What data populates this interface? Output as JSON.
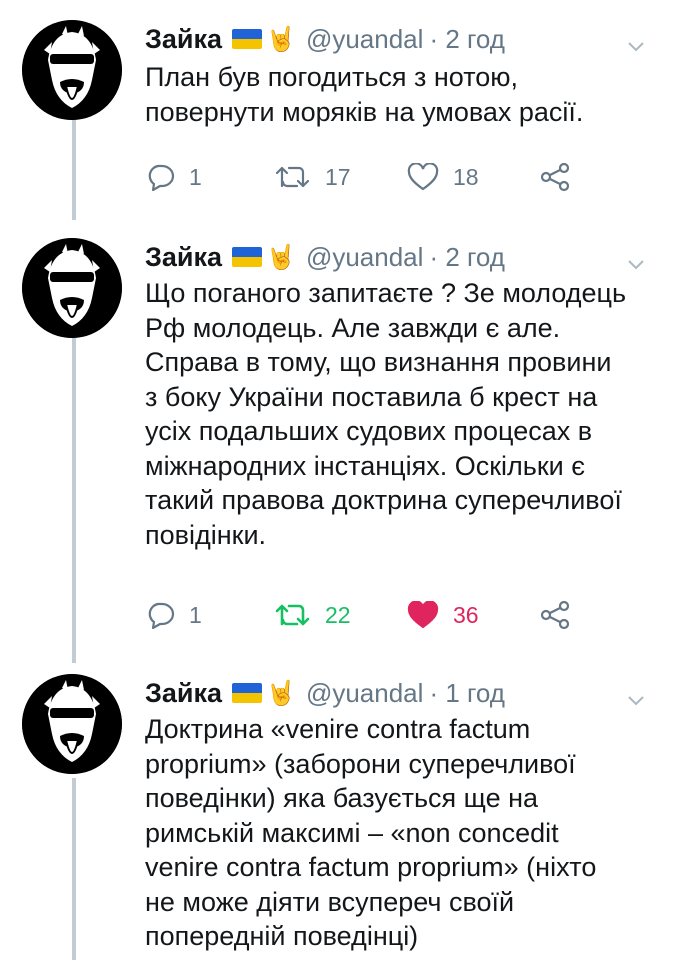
{
  "tweets": [
    {
      "name": "Зайка",
      "handle": "@yuandal",
      "time": "· 2 год",
      "text": "План був погодиться з нотою,\nповернути моряків на умовах расії.",
      "replies": "1",
      "retweets": "17",
      "likes": "18",
      "retweeted": false,
      "liked": false
    },
    {
      "name": "Зайка",
      "handle": "@yuandal",
      "time": "· 2 год",
      "text": "Що поганого запитаєте ? Зе молодець\nРф молодець. Але завжди є але.\nСправа в тому, що визнання провини\nз боку України поставила б крест на\nусіх подальших судових процесах в\nміжнародних інстанціях. Оскільки є\nтакий правова доктрина суперечливої\nповідінки.",
      "replies": "1",
      "retweets": "22",
      "likes": "36",
      "retweeted": true,
      "liked": true
    },
    {
      "name": "Зайка",
      "handle": "@yuandal",
      "time": "· 1 год",
      "text": "Доктрина «venire contra factum\nproprium» (заборони суперечливої\nповедінки) яка базується ще на\nримській максимі – «non concedit\nvenire contra factum proprium» (ніхто\nне може діяти всупереч своїй\nпопередній поведінці)",
      "replies": "",
      "retweets": "",
      "likes": "",
      "retweeted": false,
      "liked": false
    }
  ],
  "colors": {
    "text": "#14171a",
    "secondary": "#657786",
    "retweet_active": "#17bf63",
    "like_active": "#e0245e",
    "thread_line": "#c4ccd3"
  },
  "icons": [
    "reply-icon",
    "retweet-icon",
    "heart-icon",
    "share-icon",
    "chevron-down-icon",
    "ukraine-flag-icon",
    "rock-hand-icon"
  ]
}
